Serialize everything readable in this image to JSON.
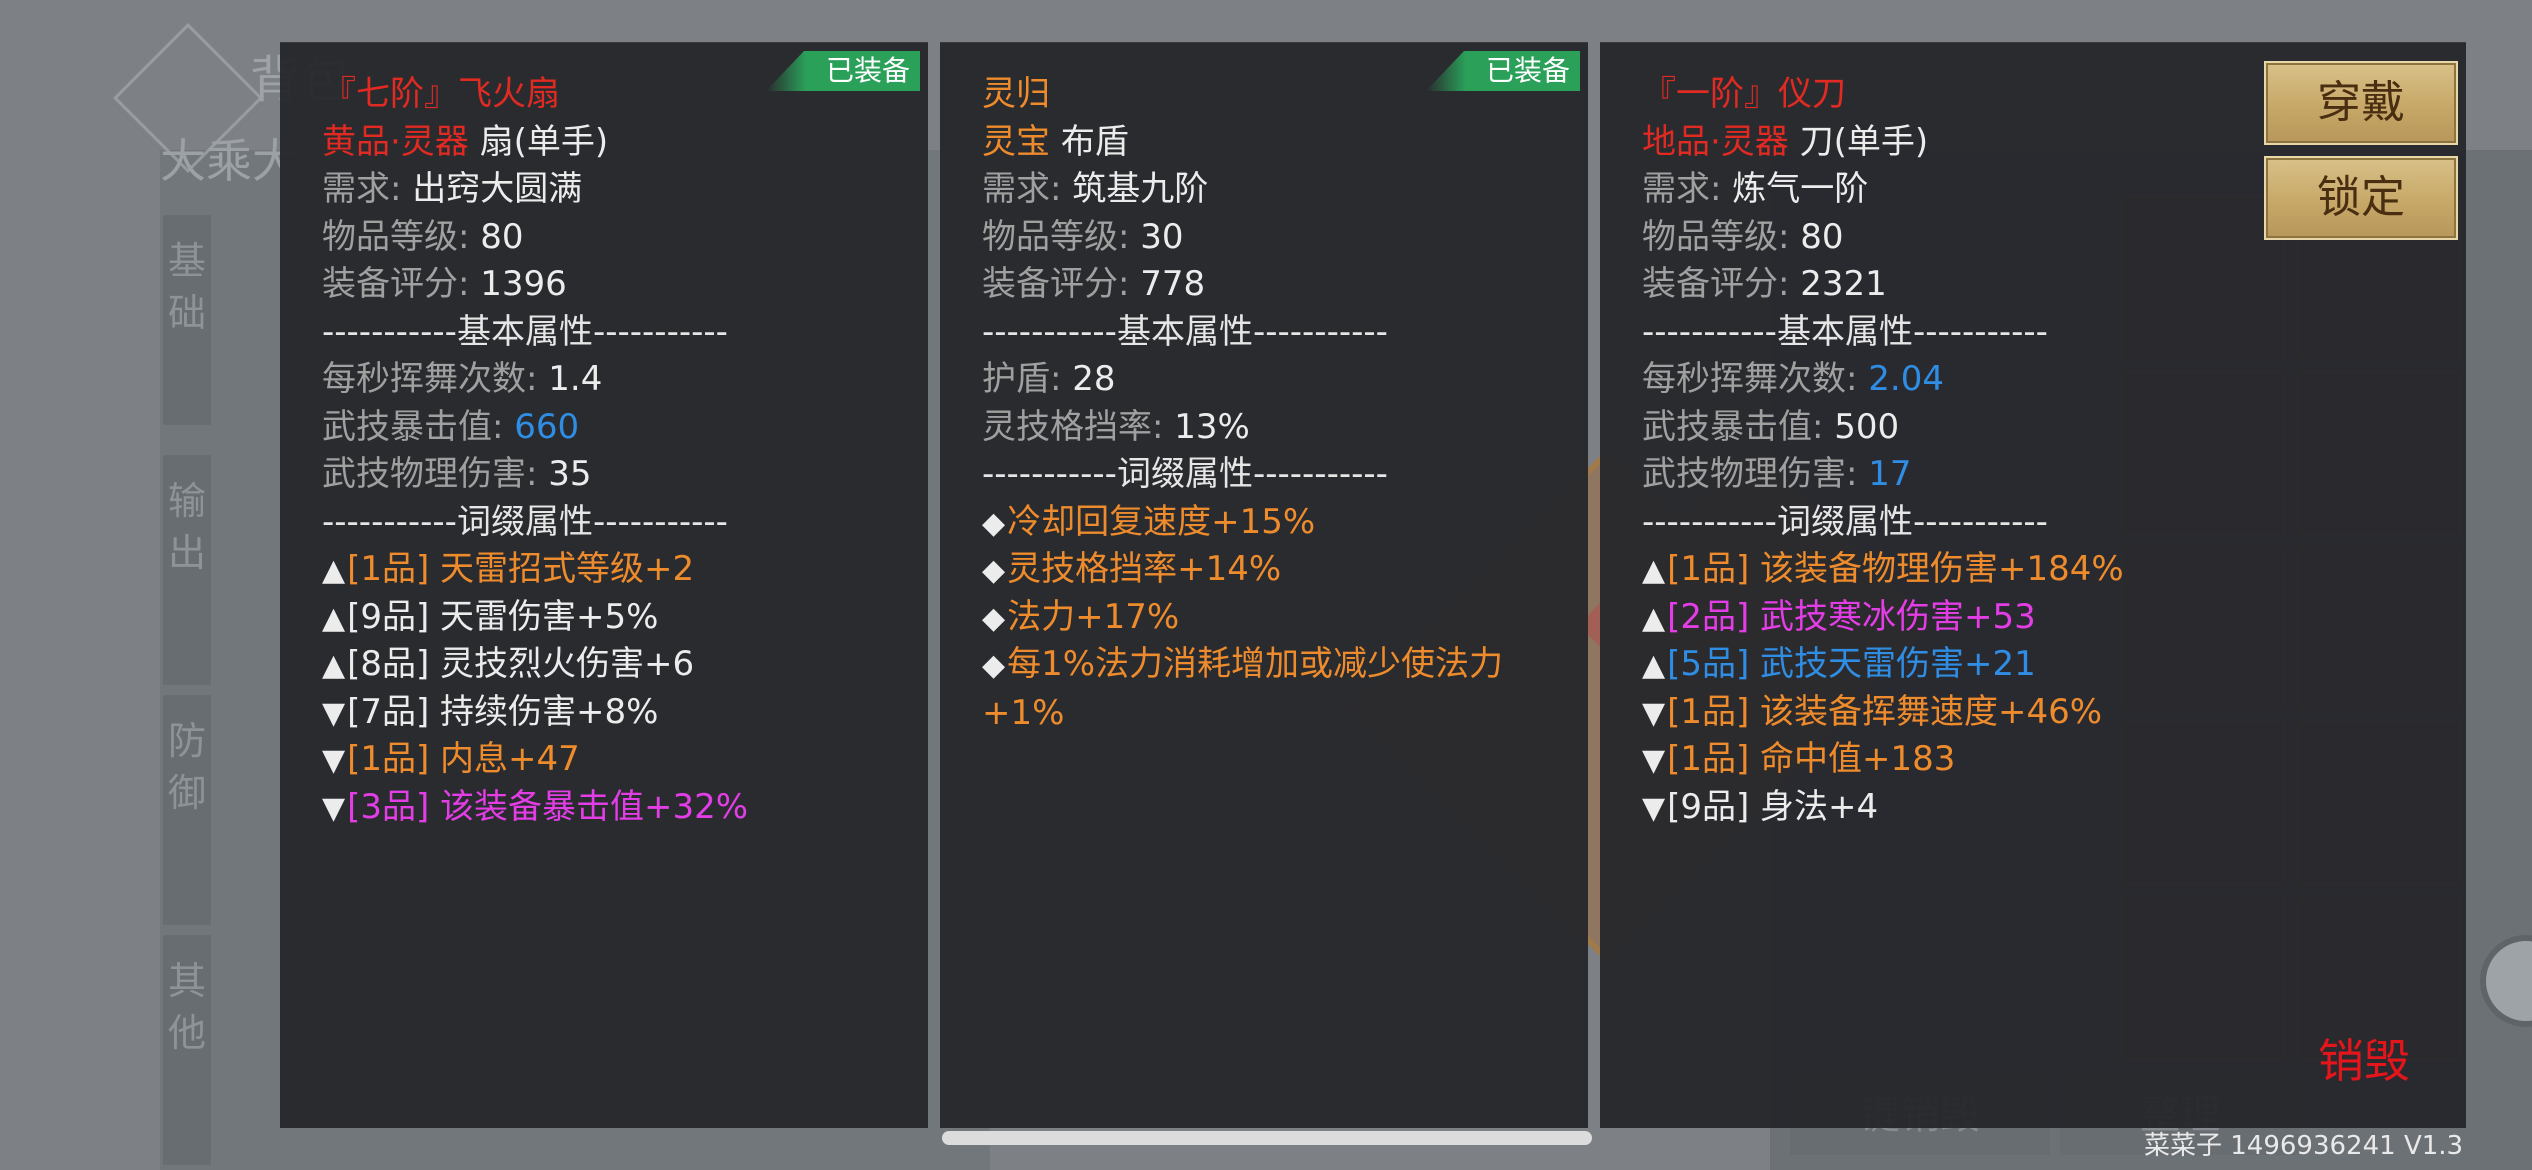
{
  "background": {
    "title": "背包",
    "subtitle": "大乘大",
    "categories": [
      "基础",
      "输出",
      "防御",
      "其他"
    ],
    "bottom_buttons": [
      "键销毁",
      "整理"
    ]
  },
  "cards": [
    {
      "equipped_badge": "已装备",
      "lines": [
        {
          "parts": [
            {
              "t": "『七阶』飞火扇",
              "c": "red"
            }
          ]
        },
        {
          "parts": [
            {
              "t": "黄品·灵器  ",
              "c": "red"
            },
            {
              "t": "扇(单手)",
              "c": "white"
            }
          ]
        },
        {
          "parts": [
            {
              "t": "需求: ",
              "c": "gray"
            },
            {
              "t": "出窍大圆满",
              "c": "white"
            }
          ]
        },
        {
          "parts": [
            {
              "t": "物品等级: ",
              "c": "gray"
            },
            {
              "t": "80",
              "c": "white"
            }
          ]
        },
        {
          "parts": [
            {
              "t": "装备评分: ",
              "c": "gray"
            },
            {
              "t": "1396",
              "c": "white"
            }
          ]
        },
        {
          "parts": [
            {
              "t": "-----------基本属性-----------",
              "c": "sep"
            }
          ]
        },
        {
          "parts": [
            {
              "t": "每秒挥舞次数: ",
              "c": "gray"
            },
            {
              "t": "1.4",
              "c": "white"
            }
          ]
        },
        {
          "parts": [
            {
              "t": "武技暴击值: ",
              "c": "gray"
            },
            {
              "t": "660",
              "c": "blue"
            }
          ]
        },
        {
          "parts": [
            {
              "t": "武技物理伤害: ",
              "c": "gray"
            },
            {
              "t": "35",
              "c": "white"
            }
          ]
        },
        {
          "parts": [
            {
              "t": "-----------词缀属性-----------",
              "c": "sep"
            }
          ]
        },
        {
          "parts": [
            {
              "t": "▲",
              "c": "white"
            },
            {
              "t": "[1品] 天雷招式等级+2",
              "c": "orange"
            }
          ]
        },
        {
          "parts": [
            {
              "t": "▲",
              "c": "white"
            },
            {
              "t": "[9品] 天雷伤害+5%",
              "c": "white"
            }
          ]
        },
        {
          "parts": [
            {
              "t": "▲",
              "c": "white"
            },
            {
              "t": "[8品] 灵技烈火伤害+6",
              "c": "white"
            }
          ]
        },
        {
          "parts": [
            {
              "t": "▼",
              "c": "white"
            },
            {
              "t": "[7品] 持续伤害+8%",
              "c": "white"
            }
          ]
        },
        {
          "parts": [
            {
              "t": "▼",
              "c": "white"
            },
            {
              "t": "[1品] 内息+47",
              "c": "orange"
            }
          ]
        },
        {
          "parts": [
            {
              "t": "▼",
              "c": "white"
            },
            {
              "t": "[3品] 该装备暴击值+32%",
              "c": "magenta"
            }
          ]
        }
      ]
    },
    {
      "equipped_badge": "已装备",
      "lines": [
        {
          "parts": [
            {
              "t": "灵归",
              "c": "orange"
            }
          ]
        },
        {
          "parts": [
            {
              "t": "灵宝  ",
              "c": "orange"
            },
            {
              "t": "布盾",
              "c": "white"
            }
          ]
        },
        {
          "parts": [
            {
              "t": "需求: ",
              "c": "gray"
            },
            {
              "t": "筑基九阶",
              "c": "white"
            }
          ]
        },
        {
          "parts": [
            {
              "t": "物品等级: ",
              "c": "gray"
            },
            {
              "t": "30",
              "c": "white"
            }
          ]
        },
        {
          "parts": [
            {
              "t": "装备评分: ",
              "c": "gray"
            },
            {
              "t": "778",
              "c": "white"
            }
          ]
        },
        {
          "parts": [
            {
              "t": "-----------基本属性-----------",
              "c": "sep"
            }
          ]
        },
        {
          "parts": [
            {
              "t": "护盾: ",
              "c": "gray"
            },
            {
              "t": "28",
              "c": "white"
            }
          ]
        },
        {
          "parts": [
            {
              "t": "灵技格挡率: ",
              "c": "gray"
            },
            {
              "t": "13%",
              "c": "white"
            }
          ]
        },
        {
          "parts": [
            {
              "t": "-----------词缀属性-----------",
              "c": "sep"
            }
          ]
        },
        {
          "parts": [
            {
              "t": "◆",
              "c": "white"
            },
            {
              "t": "冷却回复速度+15%",
              "c": "orange"
            }
          ]
        },
        {
          "parts": [
            {
              "t": "◆",
              "c": "white"
            },
            {
              "t": "灵技格挡率+14%",
              "c": "orange"
            }
          ]
        },
        {
          "parts": [
            {
              "t": "◆",
              "c": "white"
            },
            {
              "t": "法力+17%",
              "c": "orange"
            }
          ]
        },
        {
          "wrap": true,
          "parts": [
            {
              "t": "◆",
              "c": "white"
            },
            {
              "t": "每1%法力消耗增加或减少使法力+1%",
              "c": "orange"
            }
          ]
        }
      ]
    },
    {
      "equipped_badge": "",
      "lines": [
        {
          "parts": [
            {
              "t": "『一阶』仪刀",
              "c": "red"
            }
          ]
        },
        {
          "parts": [
            {
              "t": "地品·灵器  ",
              "c": "red"
            },
            {
              "t": "刀(单手)",
              "c": "white"
            }
          ]
        },
        {
          "parts": [
            {
              "t": "需求: ",
              "c": "gray"
            },
            {
              "t": "炼气一阶",
              "c": "white"
            }
          ]
        },
        {
          "parts": [
            {
              "t": "物品等级: ",
              "c": "gray"
            },
            {
              "t": "80",
              "c": "white"
            }
          ]
        },
        {
          "parts": [
            {
              "t": "装备评分: ",
              "c": "gray"
            },
            {
              "t": "2321",
              "c": "white"
            }
          ]
        },
        {
          "parts": [
            {
              "t": "-----------基本属性-----------",
              "c": "sep"
            }
          ]
        },
        {
          "parts": [
            {
              "t": "每秒挥舞次数: ",
              "c": "gray"
            },
            {
              "t": "2.04",
              "c": "blue"
            }
          ]
        },
        {
          "parts": [
            {
              "t": "武技暴击值: ",
              "c": "gray"
            },
            {
              "t": "500",
              "c": "white"
            }
          ]
        },
        {
          "parts": [
            {
              "t": "武技物理伤害: ",
              "c": "gray"
            },
            {
              "t": "17",
              "c": "blue"
            }
          ]
        },
        {
          "parts": [
            {
              "t": "-----------词缀属性-----------",
              "c": "sep"
            }
          ]
        },
        {
          "parts": [
            {
              "t": "▲",
              "c": "white"
            },
            {
              "t": "[1品] 该装备物理伤害+184%",
              "c": "orange"
            }
          ]
        },
        {
          "parts": [
            {
              "t": "▲",
              "c": "white"
            },
            {
              "t": "[2品] 武技寒冰伤害+53",
              "c": "magenta"
            }
          ]
        },
        {
          "parts": [
            {
              "t": "▲",
              "c": "white"
            },
            {
              "t": "[5品] 武技天雷伤害+21",
              "c": "blue"
            }
          ]
        },
        {
          "parts": [
            {
              "t": "▼",
              "c": "white"
            },
            {
              "t": "[1品] 该装备挥舞速度+46%",
              "c": "orange"
            }
          ]
        },
        {
          "parts": [
            {
              "t": "▼",
              "c": "white"
            },
            {
              "t": "[1品] 命中值+183",
              "c": "orange"
            }
          ]
        },
        {
          "parts": [
            {
              "t": "▼",
              "c": "white"
            },
            {
              "t": "[9品] 身法+4",
              "c": "white"
            }
          ]
        }
      ]
    }
  ],
  "actions": {
    "wear_label": "穿戴",
    "lock_label": "锁定",
    "destroy_label": "销毁"
  },
  "footer": {
    "version_text": "菜菜子 1496936241 V1.3"
  }
}
